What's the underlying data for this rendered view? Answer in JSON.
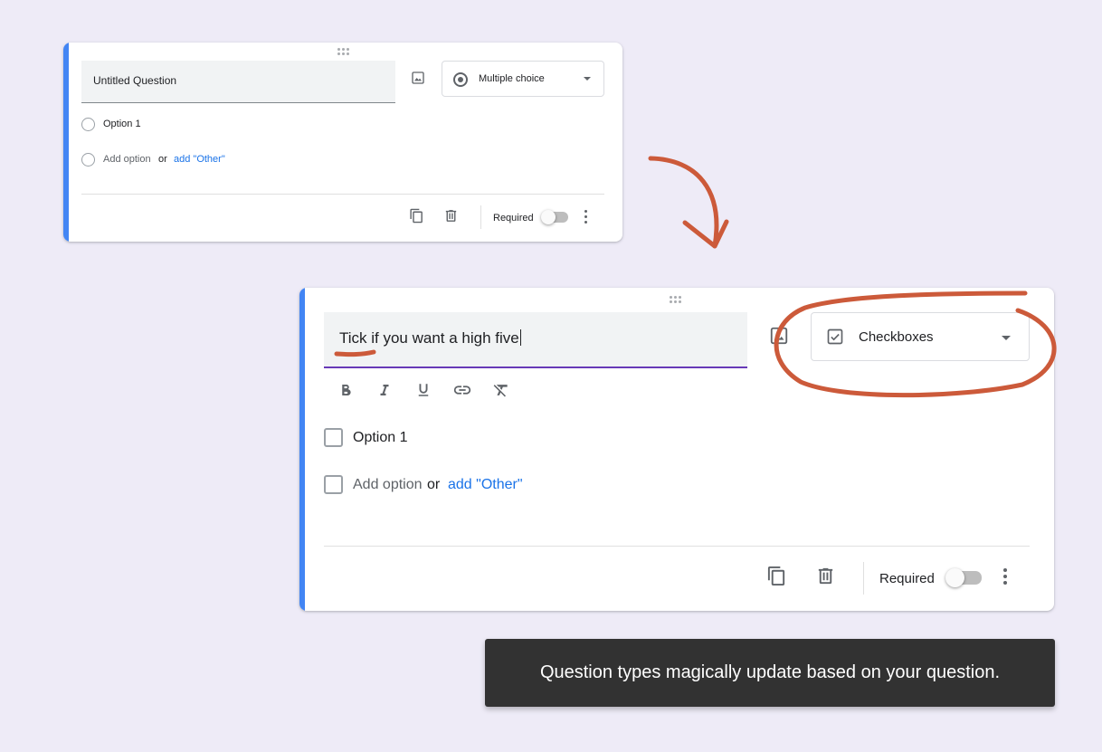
{
  "colors": {
    "background": "#eeebf7",
    "card_accent": "#4285f4",
    "link": "#1a73e8",
    "focus_underline": "#673ab7",
    "annotation": "#cc5a3a",
    "toast_bg": "#323232"
  },
  "card_before": {
    "question_title": "Untitled Question",
    "question_type": "Multiple choice",
    "question_type_icon": "radio-button-icon",
    "options": [
      {
        "label": "Option 1"
      }
    ],
    "add_option": "Add option",
    "or": "or",
    "add_other": "add \"Other\"",
    "required_label": "Required",
    "required": false
  },
  "card_after": {
    "question_title": "Tick if you want a high five",
    "question_type": "Checkboxes",
    "question_type_icon": "checkbox-icon",
    "format_tools": [
      "bold-icon",
      "italic-icon",
      "underline-icon",
      "link-icon",
      "clear-format-icon"
    ],
    "options": [
      {
        "label": "Option 1"
      }
    ],
    "add_option": "Add option",
    "or": "or",
    "add_other": "add \"Other\"",
    "required_label": "Required",
    "required": false
  },
  "toast": {
    "message": "Question types magically update based on your question."
  }
}
